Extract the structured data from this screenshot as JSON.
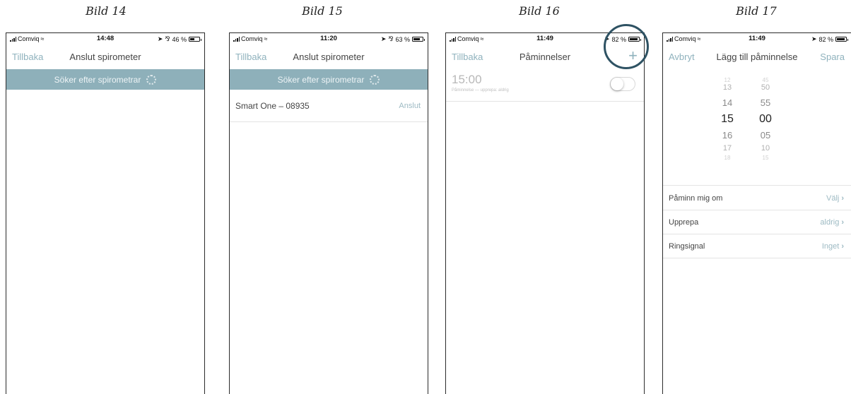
{
  "captions": [
    "Bild 14",
    "Bild 15",
    "Bild 16",
    "Bild 17"
  ],
  "colors": {
    "accent": "#8fb2bd",
    "banner": "#8eb0ba",
    "highlight": "#2e5263"
  },
  "screens": [
    {
      "status": {
        "carrier": "Comviq",
        "time": "14:48",
        "right": "46 %",
        "battery": 0.46
      },
      "nav": {
        "left": "Tillbaka",
        "title": "Anslut spirometer"
      },
      "banner": "Söker efter spirometrar"
    },
    {
      "status": {
        "carrier": "Comviq",
        "time": "11:20",
        "right": "63 %",
        "battery": 0.63
      },
      "nav": {
        "left": "Tillbaka",
        "title": "Anslut spirometer"
      },
      "banner": "Söker efter spirometrar",
      "device": {
        "name": "Smart One – 08935",
        "action": "Anslut"
      }
    },
    {
      "status": {
        "carrier": "Comviq",
        "time": "11:49",
        "right": "82 %",
        "battery": 0.82
      },
      "nav": {
        "left": "Tillbaka",
        "title": "Påminnelser",
        "add_icon": "plus-icon"
      },
      "reminder": {
        "time": "15:00",
        "subtitle": "Påminnelse — upprepa: aldrig",
        "enabled": false
      }
    },
    {
      "status": {
        "carrier": "Comviq",
        "time": "11:49",
        "right": "82 %",
        "battery": 0.82
      },
      "nav": {
        "left": "Avbryt",
        "title": "Lägg till påminnelse",
        "right": "Spara"
      },
      "picker": {
        "hours": [
          "12",
          "13",
          "14",
          "15",
          "16",
          "17",
          "18"
        ],
        "minutes": [
          "45",
          "50",
          "55",
          "00",
          "05",
          "10",
          "15"
        ],
        "selected_hour": "15",
        "selected_minute": "00"
      },
      "rows": [
        {
          "label": "Påminn mig om",
          "value": "Välj"
        },
        {
          "label": "Upprepa",
          "value": "aldrig"
        },
        {
          "label": "Ringsignal",
          "value": "Inget"
        }
      ]
    }
  ]
}
